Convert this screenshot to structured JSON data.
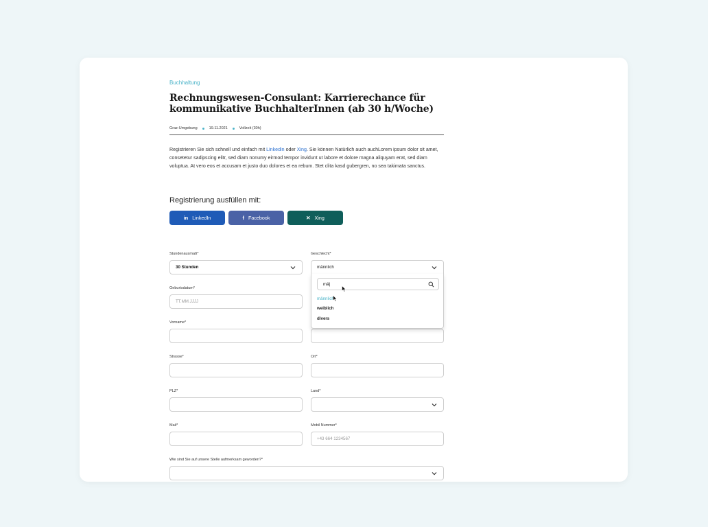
{
  "job": {
    "category": "Buchhaltung",
    "title": "Rechnungswesen-Consulant: Karrierechance für kommunikative BuchhalterInnen (ab 30 h/Woche)",
    "location": "Graz-Umgebung",
    "date": "19.11.2021",
    "type": "Vollzeit (30h)",
    "intro_part1": "Registrieren Sie sich schnell und einfach mit ",
    "intro_link1": "Linkedin",
    "intro_part2": " oder ",
    "intro_link2": "Xing",
    "intro_part3": ". Sie können Natürlich auch auchLorem ipsum dolor sit amet, consetetur sadipscing elitr, sed diam nonumy eirmod tempor invidunt ut labore et dolore magna aliquyam erat, sed diam voluptua. At vero eos et accusam et justo duo dolores et ea rebum. Stet clita kasd gubergren, no sea takimata sanctus."
  },
  "registration": {
    "heading": "Registrierung ausfüllen mit:",
    "linkedin_label": "LinkedIn",
    "facebook_label": "Facebook",
    "xing_label": "Xing",
    "linkedin_icon": "in",
    "facebook_icon": "f",
    "xing_icon": "✕"
  },
  "form": {
    "hours_label": "Stundenausmaß*",
    "hours_value": "30 Stunden",
    "gender_label": "Geschlecht*",
    "gender_value": "männlich",
    "gender_search": "mä|",
    "gender_options": [
      "männlich",
      "weiblich",
      "divers"
    ],
    "birthdate_label": "Geburtsdatum*",
    "birthdate_placeholder": "TT.MM.JJJJ",
    "firstname_label": "Vorname*",
    "street_label": "Strasse*",
    "city_label": "Ort*",
    "zip_label": "PLZ*",
    "country_label": "Land*",
    "mail_label": "Mail*",
    "mobile_label": "Mobil Nummer*",
    "mobile_placeholder": "+43 664 1234567",
    "source_label": "Wie sind Sie auf unsere Stelle aufmerksam geworden?*"
  },
  "colors": {
    "accent": "#4ab3c8",
    "linkedin": "#1f5bb7",
    "facebook": "#4a62a6",
    "xing": "#0f5e5a",
    "background": "#eef6f8"
  }
}
